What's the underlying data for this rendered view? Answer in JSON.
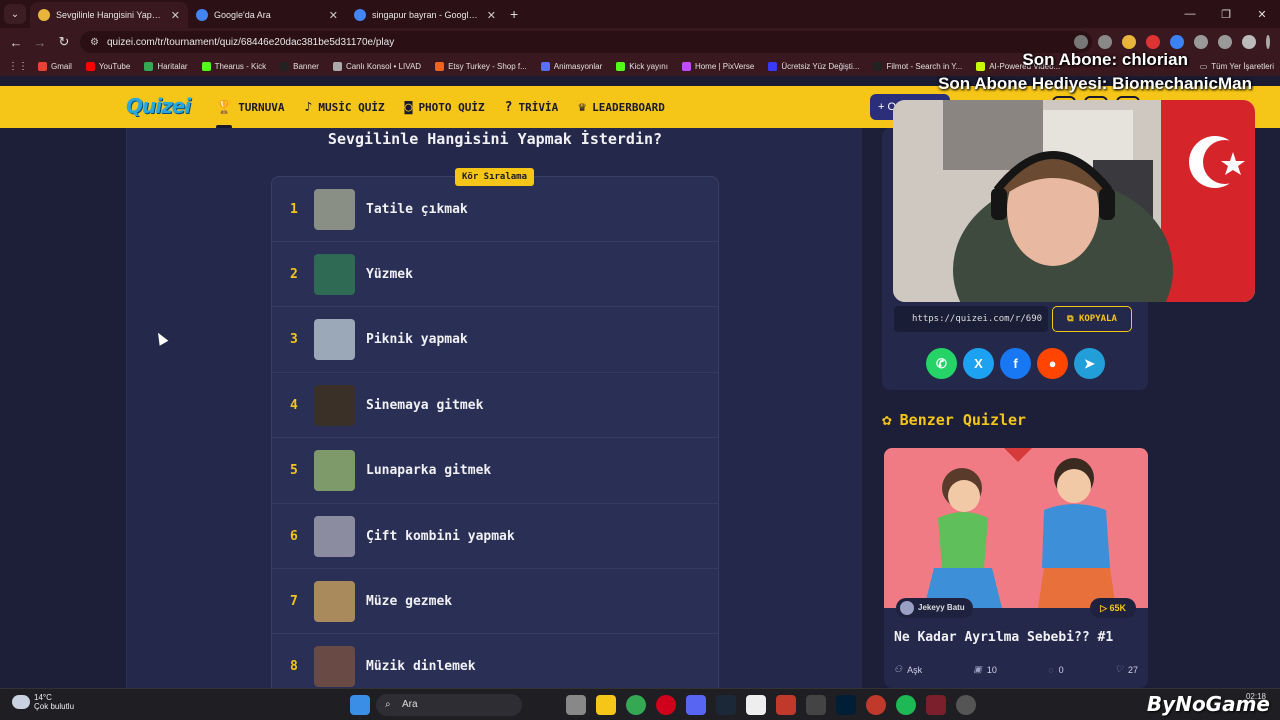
{
  "browser": {
    "tabs": [
      {
        "title": "Sevgilinle Hangisini Yapmak İste",
        "favicon": "#e8b43a",
        "active": true
      },
      {
        "title": "Google'da Ara",
        "favicon": "#4285f4",
        "active": false
      },
      {
        "title": "singapur bayran - Google'da Ara",
        "favicon": "#4285f4",
        "active": false
      }
    ],
    "new_tab": "+",
    "url": "quizei.com/tr/tournament/quiz/68446e20dac381be5d31170e/play",
    "bookmarks": [
      {
        "label": "Gmail",
        "color": "#ea4335"
      },
      {
        "label": "YouTube",
        "color": "#ff0000"
      },
      {
        "label": "Haritalar",
        "color": "#34a853"
      },
      {
        "label": "Thearus - Kick",
        "color": "#53fc18"
      },
      {
        "label": "Banner",
        "color": "#222222"
      },
      {
        "label": "Canlı Konsol • LIVAD",
        "color": "#aaaaaa"
      },
      {
        "label": "Etsy Turkey - Shop f...",
        "color": "#f1641e"
      },
      {
        "label": "Animasyonlar",
        "color": "#5b6cff"
      },
      {
        "label": "Kick yayını",
        "color": "#53fc18"
      },
      {
        "label": "Home | PixVerse",
        "color": "#c04cff"
      },
      {
        "label": "Ücretsiz Yüz Değişti...",
        "color": "#3a3aff"
      },
      {
        "label": "Filmot - Search in Y...",
        "color": "#222222"
      },
      {
        "label": "AI-Powered Video...",
        "color": "#c6ff00"
      }
    ],
    "bookmarks_end": "Tüm Yer İşaretleri"
  },
  "site": {
    "logo": "Quizei",
    "nav": [
      {
        "label": "TURNUVA",
        "icon": "trophy-icon",
        "glyph": "🏆",
        "active": true
      },
      {
        "label": "MUSİC QUİZ",
        "icon": "music-icon",
        "glyph": "♪",
        "active": false
      },
      {
        "label": "PHOTO QUİZ",
        "icon": "camera-icon",
        "glyph": "◙",
        "active": false
      },
      {
        "label": "TRİVİA",
        "icon": "chat-icon",
        "glyph": "?",
        "active": false
      },
      {
        "label": "LEADERBOARD",
        "icon": "trophy-outline-icon",
        "glyph": "♛",
        "active": false
      }
    ],
    "create_label": "+ O"
  },
  "quiz": {
    "title": "Sevgilinle Hangisini Yapmak İsterdin?",
    "badge": "Kör Sıralama",
    "items": [
      {
        "rank": "1",
        "label": "Tatile çıkmak",
        "thumb": "#8a8f86"
      },
      {
        "rank": "2",
        "label": "Yüzmek",
        "thumb": "#2f6a55"
      },
      {
        "rank": "3",
        "label": "Piknik yapmak",
        "thumb": "#9aa8b8"
      },
      {
        "rank": "4",
        "label": "Sinemaya gitmek",
        "thumb": "#3a3028"
      },
      {
        "rank": "5",
        "label": "Lunaparka gitmek",
        "thumb": "#7f9a6a"
      },
      {
        "rank": "6",
        "label": "Çift kombini yapmak",
        "thumb": "#8c8ca0"
      },
      {
        "rank": "7",
        "label": "Müze gezmek",
        "thumb": "#a88a5c"
      },
      {
        "rank": "8",
        "label": "Müzik dinlemek",
        "thumb": "#6a4a44"
      }
    ]
  },
  "share": {
    "url": "https://quizei.com/r/690",
    "copy_label": "KOPYALA",
    "socials": [
      {
        "name": "whatsapp-icon",
        "glyph": "✆",
        "color": "#25d366"
      },
      {
        "name": "x-icon",
        "glyph": "X",
        "color": "#1da1f2"
      },
      {
        "name": "facebook-icon",
        "glyph": "f",
        "color": "#1877f2"
      },
      {
        "name": "reddit-icon",
        "glyph": "●",
        "color": "#ff4500"
      },
      {
        "name": "telegram-icon",
        "glyph": "➤",
        "color": "#229ed9"
      }
    ]
  },
  "similar": {
    "title": "Benzer Quizler",
    "card": {
      "author": "Jekeyy Batu",
      "plays": "▷ 65K",
      "title": "Ne Kadar Ayrılma Sebebi?? #1",
      "category": "Aşk",
      "questions": "10",
      "comments": "0",
      "likes": "27"
    }
  },
  "stream": {
    "line1": "Son Abone: chlorian",
    "line2": "Son Abone Hediyesi: BiomechanicMan"
  },
  "taskbar": {
    "temp": "14°C",
    "weather": "Çok bulutlu",
    "search": "Ara",
    "time": "02:18",
    "watermark": "ByNoGame"
  }
}
